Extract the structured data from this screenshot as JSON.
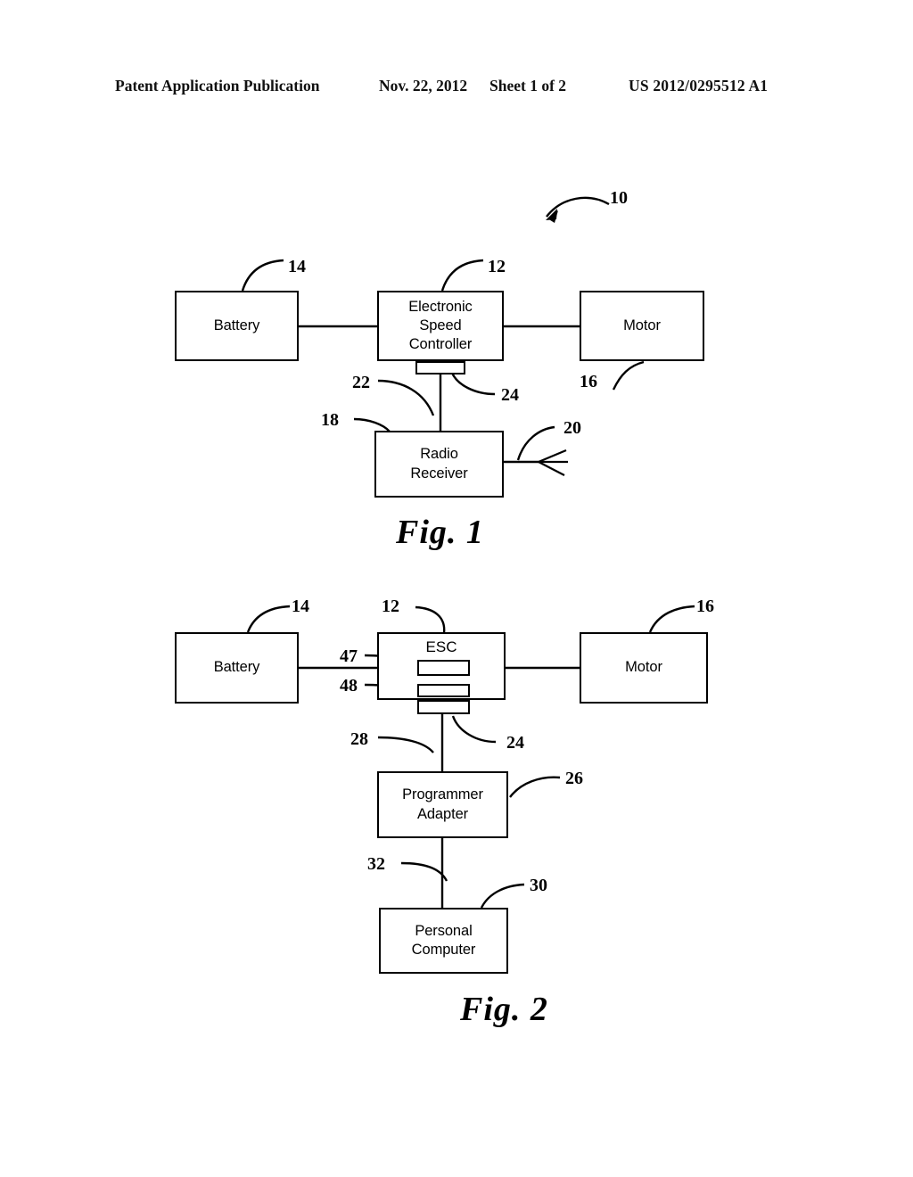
{
  "header": {
    "publication": "Patent Application Publication",
    "date": "Nov. 22, 2012",
    "sheet": "Sheet 1 of 2",
    "document_number": "US 2012/0295512 A1"
  },
  "figures": [
    {
      "caption": "Fig. 1",
      "system_ref": "10",
      "blocks": [
        {
          "label": "Battery",
          "ref": "14"
        },
        {
          "label": "Electronic Speed Controller",
          "line1": "Electronic",
          "line2": "Speed",
          "line3": "Controller",
          "ref": "12"
        },
        {
          "label": "Motor",
          "ref": "16"
        },
        {
          "label": "Radio Receiver",
          "line1": "Radio",
          "line2": "Receiver",
          "ref": "18"
        }
      ],
      "refs": {
        "system": "10",
        "battery": "14",
        "esc": "12",
        "motor": "16",
        "receiver": "18",
        "antenna": "20",
        "cable": "22",
        "connector": "24"
      }
    },
    {
      "caption": "Fig. 2",
      "blocks": [
        {
          "label": "Battery",
          "ref": "14"
        },
        {
          "label": "ESC",
          "ref": "12"
        },
        {
          "label": "Motor",
          "ref": "16"
        },
        {
          "label": "Programmer Adapter",
          "line1": "Programmer",
          "line2": "Adapter",
          "ref": "26"
        },
        {
          "label": "Personal Computer",
          "line1": "Personal",
          "line2": "Computer",
          "ref": "30"
        }
      ],
      "refs": {
        "battery": "14",
        "esc": "12",
        "motor": "16",
        "esc_inner_upper": "47",
        "esc_inner_lower": "48",
        "cable_to_adapter": "28",
        "connector": "24",
        "adapter": "26",
        "cable_to_pc": "32",
        "computer": "30"
      }
    }
  ],
  "style": {
    "line_color": "#000000",
    "background": "#ffffff"
  }
}
